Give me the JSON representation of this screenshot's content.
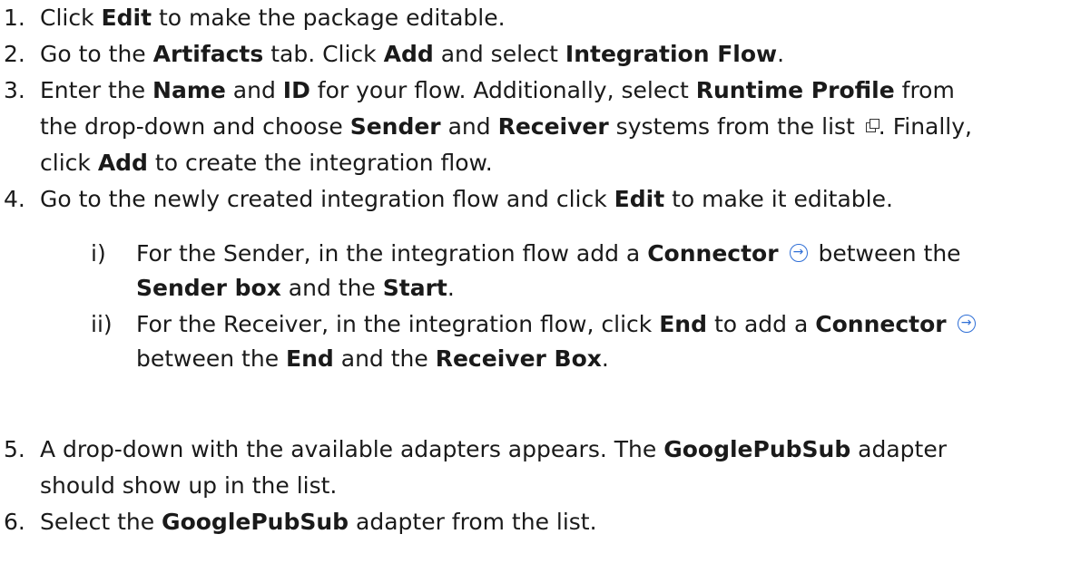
{
  "steps": [
    {
      "num": "1.",
      "pre": "Click ",
      "b1": "Edit",
      "post": " to make the package editable."
    },
    {
      "num": "2.",
      "pre": "Go to the ",
      "b1": "Artifacts",
      "mid1": " tab. Click ",
      "b2": "Add",
      "mid2": " and select ",
      "b3": "Integration Flow",
      "post": "."
    },
    {
      "num": "3.",
      "pre": "Enter the ",
      "b1": "Name",
      "mid1": " and ",
      "b2": "ID",
      "mid2": " for your flow. Additionally, select ",
      "b3": "Runtime Profile",
      "post": " from",
      "line2_pre": "the drop-down and choose ",
      "line2_b1": "Sender",
      "line2_mid": " and ",
      "line2_b2": "Receiver",
      "line2_post": " systems from the list",
      "line2_end": ". Finally,",
      "line3_pre": "click ",
      "line3_b": "Add",
      "line3_post": " to create the integration flow."
    },
    {
      "num": "4.",
      "pre": "Go to the newly created integration flow and click ",
      "b1": "Edit",
      "post": " to make it editable."
    },
    {
      "num": "5.",
      "pre": "A drop-down with the available adapters appears. The ",
      "b1": "GooglePubSub",
      "post": " adapter",
      "line2": "should show up in the list."
    },
    {
      "num": "6.",
      "pre": "Select the ",
      "b1": "GooglePubSub",
      "post": " adapter from the list."
    }
  ],
  "substeps": [
    {
      "num": "i)",
      "pre": "For the Sender, in the integration flow add a ",
      "b1": "Connector",
      "post": " between the",
      "line2_b1": "Sender box",
      "line2_mid": " and the ",
      "line2_b2": "Start",
      "line2_post": "."
    },
    {
      "num": "ii)",
      "pre": "For the Receiver, in the integration flow, click ",
      "b1": "End",
      "mid": " to add a ",
      "b2": "Connector",
      "line2_pre": "between the ",
      "line2_b1": "End",
      "line2_mid": " and the ",
      "line2_b2": "Receiver Box",
      "line2_post": "."
    }
  ],
  "icons": {
    "connector": "arrow-circle-icon",
    "external": "external-link-icon",
    "color": "#2f6fd6"
  }
}
